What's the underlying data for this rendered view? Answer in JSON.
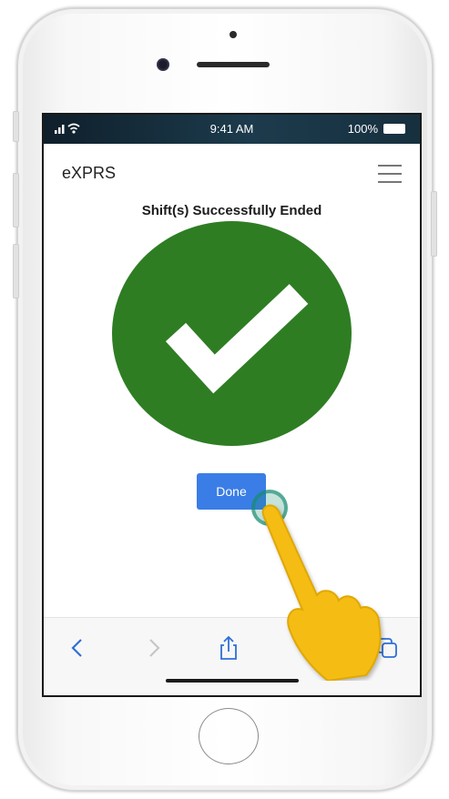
{
  "status_bar": {
    "time": "9:41 AM",
    "battery_percent": "100%",
    "battery_level": 1.0
  },
  "header": {
    "app_title": "eXPRS",
    "menu_icon": "hamburger-menu-icon"
  },
  "main": {
    "heading": "Shift(s) Successfully Ended",
    "success_icon": "checkmark-icon",
    "done_label": "Done"
  },
  "toolbar": {
    "icons": [
      "back-icon",
      "forward-icon",
      "share-icon",
      "tabs-icon"
    ]
  },
  "colors": {
    "success_green": "#2e7d23",
    "button_blue": "#3a7de6",
    "tap_ring": "#178c6e",
    "pointer_hand": "#f5bd14",
    "toolbar_icon_blue": "#2f6fd6",
    "toolbar_icon_disabled": "#c6c6c6"
  }
}
